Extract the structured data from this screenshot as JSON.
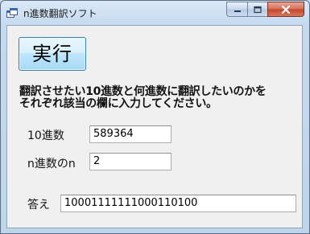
{
  "window": {
    "title": "n進数翻訳ソフト"
  },
  "icons": {
    "app": "window-app-icon",
    "minimize": "minimize-icon",
    "maximize": "maximize-icon",
    "close": "close-icon"
  },
  "form": {
    "execute_label": "実行",
    "instruction": "翻訳させたい10進数と何進数に翻訳したいのかを\nそれぞれ該当の欄に入力してください。",
    "decimal_label": "10進数",
    "decimal_value": "589364",
    "base_label": "n進数のn",
    "base_value": "2",
    "answer_label": "答え",
    "answer_value": "10001111111000110100"
  },
  "colors": {
    "close_button": "#c3462a",
    "execute_button": "#bee6fd"
  }
}
